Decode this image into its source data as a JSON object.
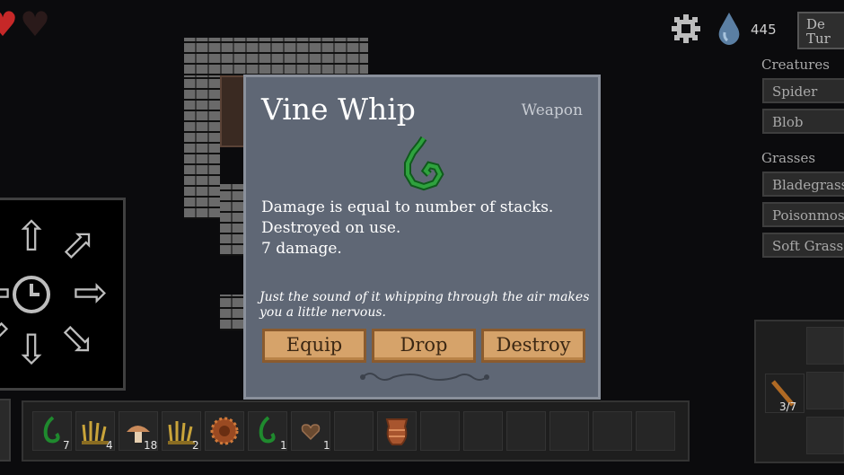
{
  "hud": {
    "currency_value": "445",
    "end_turn_label": "De\nTur"
  },
  "right_panel": {
    "creatures_title": "Creatures",
    "creatures": [
      "Spider",
      "Blob"
    ],
    "grasses_title": "Grasses",
    "grasses": [
      "Bladegrass",
      "Poisonmos",
      "Soft Grass"
    ]
  },
  "equip_slot": {
    "count": "3/7"
  },
  "inventory": {
    "slots": [
      {
        "icon": "vine-whip-icon",
        "count": "7"
      },
      {
        "icon": "wheat-grass-icon",
        "count": "4"
      },
      {
        "icon": "mushroom-icon",
        "count": "18"
      },
      {
        "icon": "wheat-grass-icon",
        "count": "2"
      },
      {
        "icon": "spiky-seed-icon",
        "count": ""
      },
      {
        "icon": "vine-whip-icon",
        "count": "1"
      },
      {
        "icon": "heart-seed-icon",
        "count": "1"
      },
      {
        "icon": "empty",
        "count": ""
      },
      {
        "icon": "pot-icon",
        "count": ""
      }
    ]
  },
  "modal": {
    "title": "Vine Whip",
    "type": "Weapon",
    "icon": "vine-whip-icon",
    "lines": [
      "Damage is equal to number of stacks.",
      "Destroyed on use.",
      "7 damage."
    ],
    "flavor": "Just the sound of it whipping through the air makes you a little nervous.",
    "buttons": {
      "equip": "Equip",
      "drop": "Drop",
      "destroy": "Destroy"
    }
  },
  "colors": {
    "modal_bg": "#5f6775",
    "button_bg": "#d6a36a",
    "vine_green": "#1f8a2e"
  }
}
